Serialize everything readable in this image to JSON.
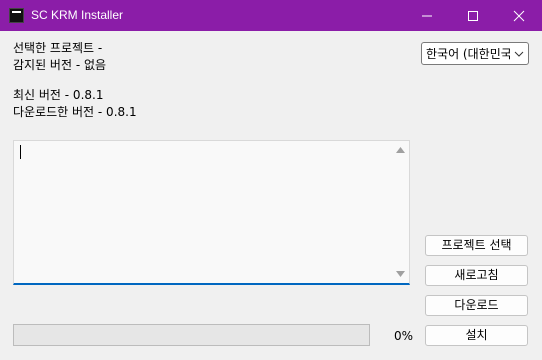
{
  "window": {
    "title": "SC KRM Installer",
    "icons": {
      "app": "app-console-icon",
      "minimize": "minimize-icon",
      "maximize": "maximize-icon",
      "close": "close-icon"
    },
    "titlebar_color": "#8b1da8"
  },
  "info": {
    "selected_project": "선택한 프로젝트 -",
    "detected_version": "감지된 버전 - 없음",
    "latest_version": "최신 버전 - 0.8.1",
    "downloaded_version": "다운로드한 버전 - 0.8.1"
  },
  "language_select": {
    "value": "한국어 (대한민국)",
    "icon": "chevron-down-icon"
  },
  "log": {
    "text": "",
    "scroll_up_icon": "scroll-up-arrow-icon",
    "scroll_down_icon": "scroll-down-arrow-icon",
    "focus_color": "#0067c0"
  },
  "buttons": {
    "select_project": "프로젝트 선택",
    "refresh": "새로고침",
    "download": "다운로드",
    "install": "설치"
  },
  "progress": {
    "value": 0,
    "label": "0%"
  }
}
